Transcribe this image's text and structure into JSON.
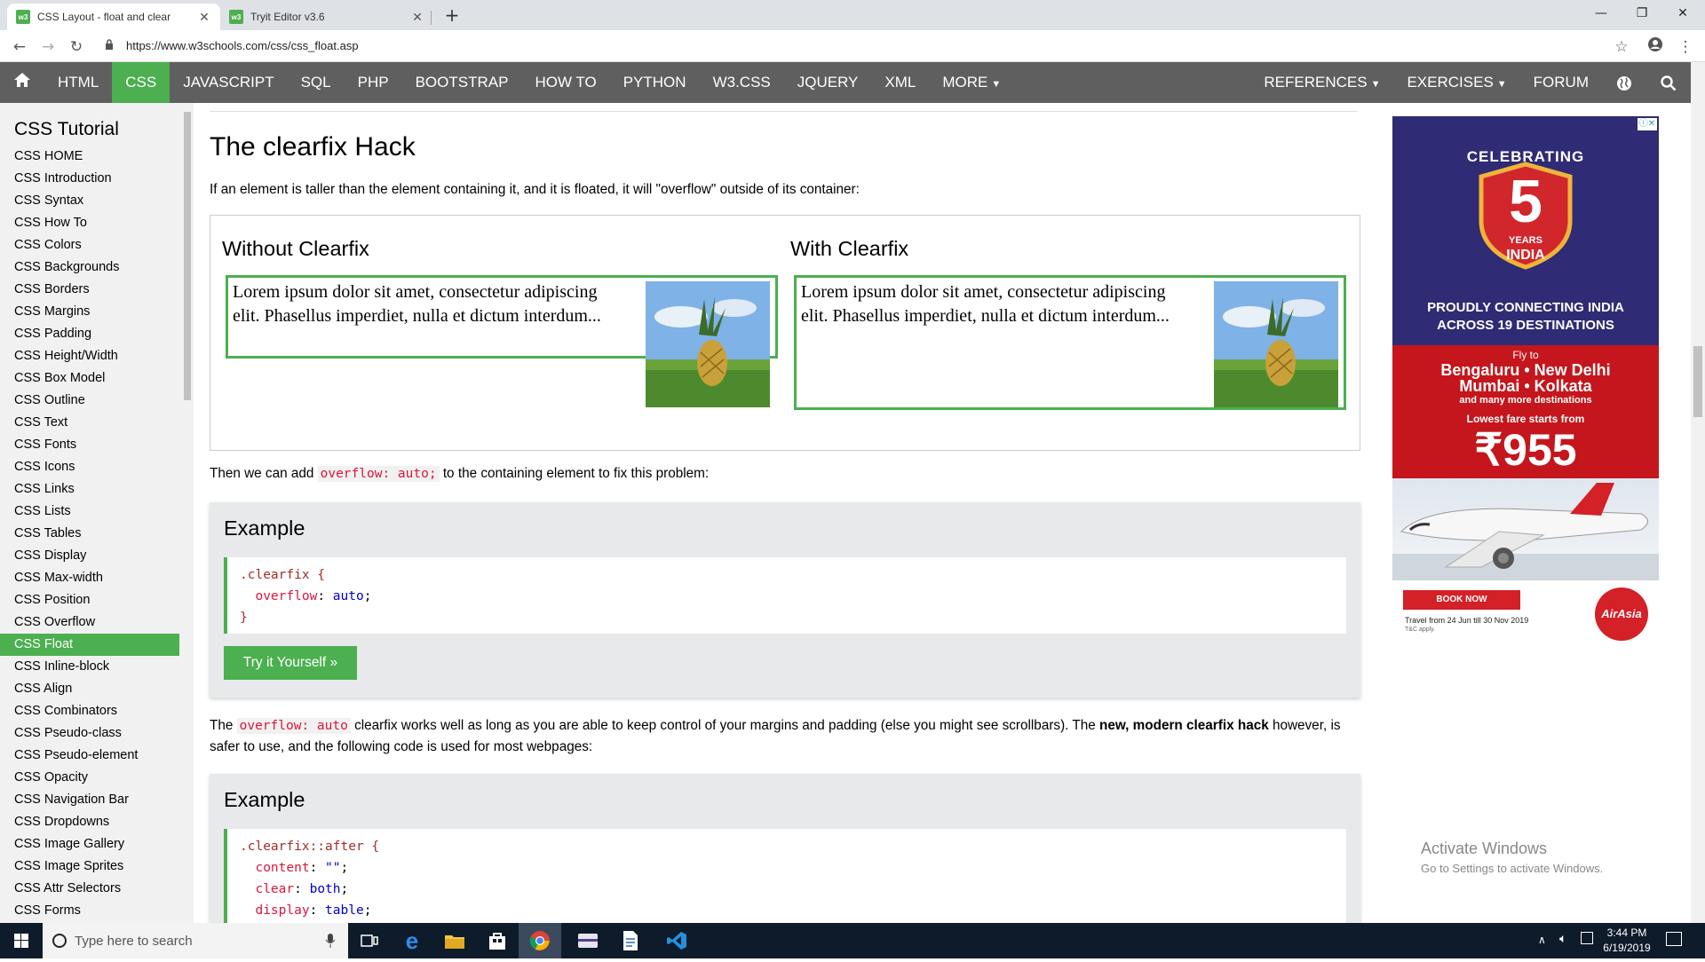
{
  "browser": {
    "tabs": [
      {
        "title": "CSS Layout - float and clear",
        "favicon": "w3"
      },
      {
        "title": "Tryit Editor v3.6",
        "favicon": "w3"
      }
    ],
    "url": "https://www.w3schools.com/css/css_float.asp"
  },
  "topnav": {
    "items": [
      "HTML",
      "CSS",
      "JAVASCRIPT",
      "SQL",
      "PHP",
      "BOOTSTRAP",
      "HOW TO",
      "PYTHON",
      "W3.CSS",
      "JQUERY",
      "XML",
      "MORE"
    ],
    "active": "CSS",
    "right": [
      "REFERENCES",
      "EXERCISES",
      "FORUM"
    ]
  },
  "sidebar": {
    "title": "CSS Tutorial",
    "items": [
      "CSS HOME",
      "CSS Introduction",
      "CSS Syntax",
      "CSS How To",
      "CSS Colors",
      "CSS Backgrounds",
      "CSS Borders",
      "CSS Margins",
      "CSS Padding",
      "CSS Height/Width",
      "CSS Box Model",
      "CSS Outline",
      "CSS Text",
      "CSS Fonts",
      "CSS Icons",
      "CSS Links",
      "CSS Lists",
      "CSS Tables",
      "CSS Display",
      "CSS Max-width",
      "CSS Position",
      "CSS Overflow",
      "CSS Float",
      "CSS Inline-block",
      "CSS Align",
      "CSS Combinators",
      "CSS Pseudo-class",
      "CSS Pseudo-element",
      "CSS Opacity",
      "CSS Navigation Bar",
      "CSS Dropdowns",
      "CSS Image Gallery",
      "CSS Image Sprites",
      "CSS Attr Selectors",
      "CSS Forms"
    ],
    "active": "CSS Float"
  },
  "main": {
    "heading": "The clearfix Hack",
    "intro": "If an element is taller than the element containing it, and it is floated, it will \"overflow\" outside of its container:",
    "without_title": "Without Clearfix",
    "with_title": "With Clearfix",
    "lorem": "Lorem ipsum dolor sit amet, consectetur adipiscing elit. Phasellus imperdiet, nulla et dictum interdum...",
    "then_before": "Then we can add",
    "then_code": "overflow: auto;",
    "then_after": "to the containing element to fix this problem:",
    "example_title": "Example",
    "example1_code": [
      ".clearfix {",
      "overflow",
      "auto",
      "}"
    ],
    "try_label": "Try it Yourself »",
    "p2_the": "The",
    "p2_code": "overflow: auto",
    "p2_rest": "clearfix works well as long as you are able to keep control of your margins and padding (else you might see scrollbars). The",
    "p2_bold": "new, modern clearfix hack",
    "p2_end": "however, is safer to use, and the following code is used for most webpages:",
    "example2_code": {
      "selector": ".clearfix::after {",
      "lines": [
        {
          "prop": "content",
          "val": "\"\""
        },
        {
          "prop": "clear",
          "val": "both"
        },
        {
          "prop": "display",
          "val": "table"
        }
      ]
    }
  },
  "ad": {
    "celebrating": "CELEBRATING",
    "five": "5",
    "years": "YEARS",
    "india": "INDIA",
    "connect1": "PROUDLY CONNECTING INDIA",
    "connect2": "ACROSS 19 DESTINATIONS",
    "fly_to": "Fly to",
    "dest1": "Bengaluru • New Delhi",
    "dest2": "Mumbai • Kolkata",
    "dest3": "and many more destinations",
    "lowest": "Lowest fare starts from",
    "price": "₹955",
    "book": "BOOK NOW",
    "travel": "Travel from 24 Jun till 30 Nov 2019",
    "tc": "T&C apply.",
    "brand": "AirAsia"
  },
  "watermark": {
    "line1": "Activate Windows",
    "line2": "Go to Settings to activate Windows."
  },
  "taskbar": {
    "search_placeholder": "Type here to search",
    "time": "3:44 PM",
    "date": "6/19/2019"
  }
}
